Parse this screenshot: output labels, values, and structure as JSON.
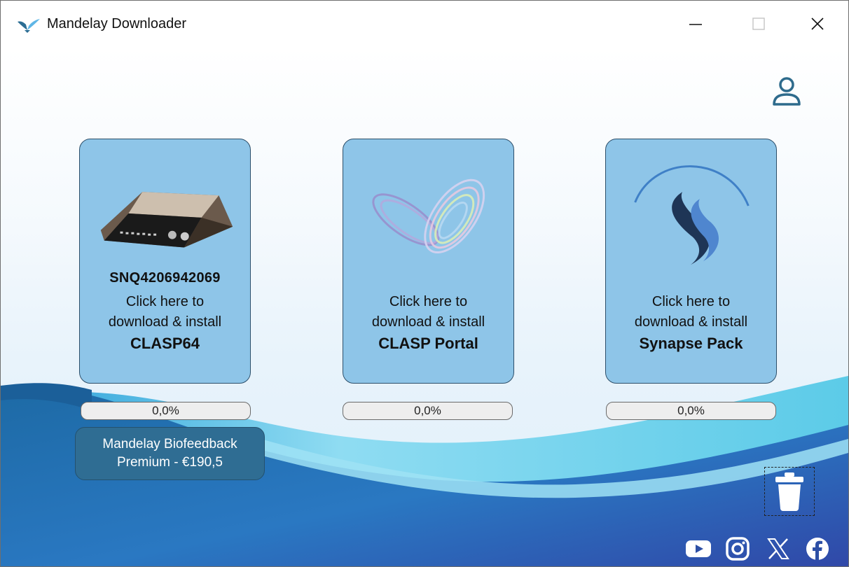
{
  "window": {
    "title": "Mandelay Downloader",
    "controls": [
      "minimize",
      "maximize",
      "close"
    ]
  },
  "icons": {
    "app": "mandelay-bird-icon",
    "user": "user-icon",
    "trash": "trash-icon",
    "social": [
      "youtube-icon",
      "instagram-icon",
      "x-icon",
      "facebook-icon"
    ]
  },
  "cards": [
    {
      "serial": "SNQ4206942069",
      "line1": "Click here to",
      "line2": "download & install",
      "name": "CLASP64",
      "image": "device-box-image",
      "progress": {
        "label": "0,0%",
        "value": 0
      }
    },
    {
      "serial": "",
      "line1": "Click here to",
      "line2": "download & install",
      "name": "CLASP Portal",
      "image": "clasp-portal-logo",
      "progress": {
        "label": "0,0%",
        "value": 0
      }
    },
    {
      "serial": "",
      "line1": "Click here to",
      "line2": "download & install",
      "name": "Synapse Pack",
      "image": "synapse-logo",
      "progress": {
        "label": "0,0%",
        "value": 0
      }
    }
  ],
  "premium": {
    "line1": "Mandelay Biofeedback",
    "line2": "Premium - €190,5"
  },
  "colors": {
    "card": "#8ec5e8",
    "premium": "#2f6d93",
    "accent": "#2e6b8c",
    "wave_dark": "#1f57a8",
    "wave_light": "#8fdcf2"
  }
}
